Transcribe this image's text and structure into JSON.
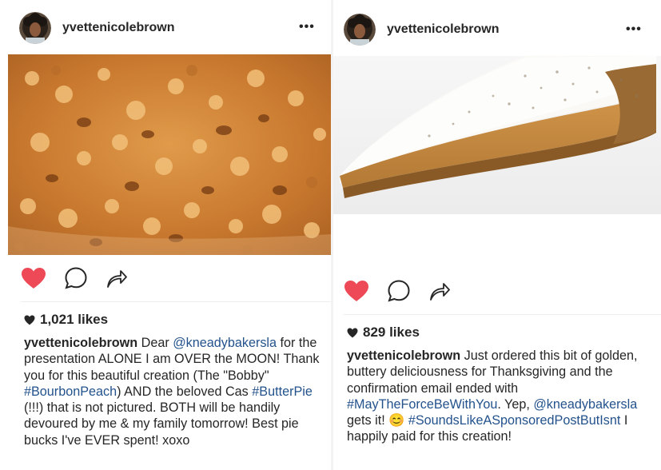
{
  "posts": [
    {
      "username": "yvettenicolebrown",
      "more_label": "•••",
      "likes": "1,021 likes",
      "caption_user": "yvettenicolebrown",
      "caption": [
        {
          "t": " Dear "
        },
        {
          "t": "@kneadybakersla",
          "link": true
        },
        {
          "t": " for the presentation ALONE I am OVER the MOON! Thank you for this beautiful creation (The \"Bobby\" "
        },
        {
          "t": "#BourbonPeach",
          "link": true
        },
        {
          "t": ") AND the beloved Cas "
        },
        {
          "t": "#ButterPie",
          "link": true
        },
        {
          "t": " (!!!) that is not pictured. BOTH will be handily devoured by me & my family tomorrow! Best pie bucks I've EVER spent! xoxo"
        }
      ]
    },
    {
      "username": "yvettenicolebrown",
      "more_label": "•••",
      "likes": "829 likes",
      "caption_user": "yvettenicolebrown",
      "caption": [
        {
          "t": " Just ordered this bit of golden, buttery deliciousness for Thanksgiving and the confirmation email ended with "
        },
        {
          "t": "#MayTheForceBeWithYou",
          "link": true
        },
        {
          "t": ". Yep, "
        },
        {
          "t": "@kneadybakersla",
          "link": true
        },
        {
          "t": " gets it! 😊 "
        },
        {
          "t": "#SoundsLikeASponsoredPostButIsnt",
          "link": true
        },
        {
          "t": " I happily paid for this creation!"
        }
      ]
    }
  ],
  "icons": {
    "like": "heart-icon",
    "comment": "comment-bubble-icon",
    "share": "share-arrow-icon",
    "likes_heart": "small-heart-icon"
  },
  "colors": {
    "like_red": "#ed4956",
    "hashtag_blue": "#23528c",
    "text": "#262626"
  }
}
